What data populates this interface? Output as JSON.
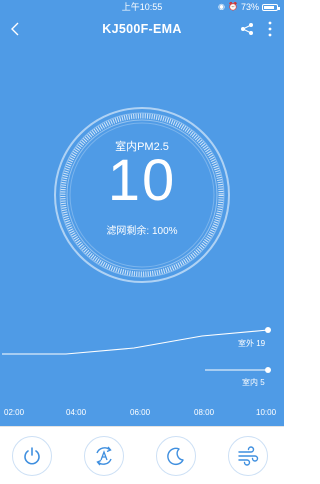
{
  "status_bar": {
    "time": "上午10:55",
    "battery": "73%"
  },
  "nav": {
    "title": "KJ500F-EMA"
  },
  "gauge": {
    "label": "室内PM2.5",
    "value": "10",
    "filter_text": "滤网剩余: 100%"
  },
  "chart_data": {
    "type": "line",
    "x": [
      "02:00",
      "04:00",
      "06:00",
      "08:00",
      "10:00"
    ],
    "series": [
      {
        "name": "室外 19",
        "values": [
          15,
          15,
          16,
          18,
          19
        ]
      },
      {
        "name": "室内 5",
        "values": [
          null,
          null,
          null,
          null,
          5
        ]
      }
    ],
    "labels": {
      "outdoor": "室外 19",
      "indoor": "室内 5"
    }
  },
  "controls": [
    {
      "name": "power"
    },
    {
      "name": "auto-mode"
    },
    {
      "name": "sleep-mode"
    },
    {
      "name": "wind-speed"
    }
  ],
  "colors": {
    "background": "#4f9be6",
    "control_icon": "#3f8fdf"
  }
}
